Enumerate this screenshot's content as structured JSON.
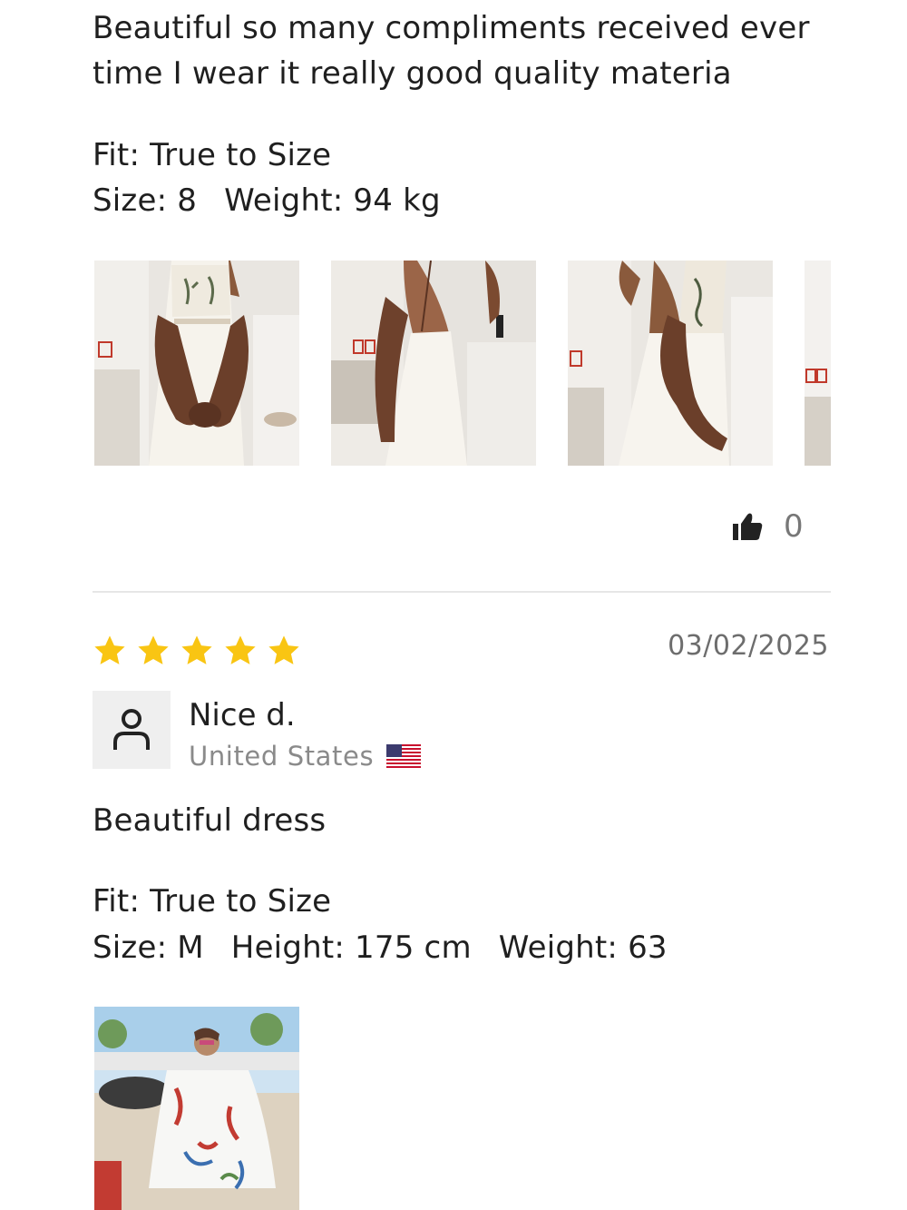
{
  "review1": {
    "body": "Beautiful so many compliments received ever time I wear it really good quality materia",
    "fit": "Fit: True to Size",
    "size": "Size: 8",
    "weight": "Weight: 94 kg",
    "photos": [
      "dress-front-photo",
      "dress-back-photo",
      "dress-side-photo",
      "dress-partial-photo"
    ],
    "likes": "0"
  },
  "review2": {
    "rating": 5,
    "date": "03/02/2025",
    "name": "Nice d.",
    "country": "United States",
    "body": "Beautiful dress",
    "fit": "Fit: True to Size",
    "size": "Size: M",
    "height": "Height: 175 cm",
    "weight": "Weight: 63",
    "photos": [
      "boat-dress-photo"
    ]
  },
  "colors": {
    "star": "#f9c513",
    "text": "#1f1f1f",
    "muted": "#8a8a8a",
    "divider": "#e6e6e6",
    "avatar_bg": "#efefef"
  },
  "icons": {
    "like": "thumbs-up-icon",
    "avatar": "user-icon",
    "flag": "us-flag-icon",
    "star": "star-icon"
  }
}
